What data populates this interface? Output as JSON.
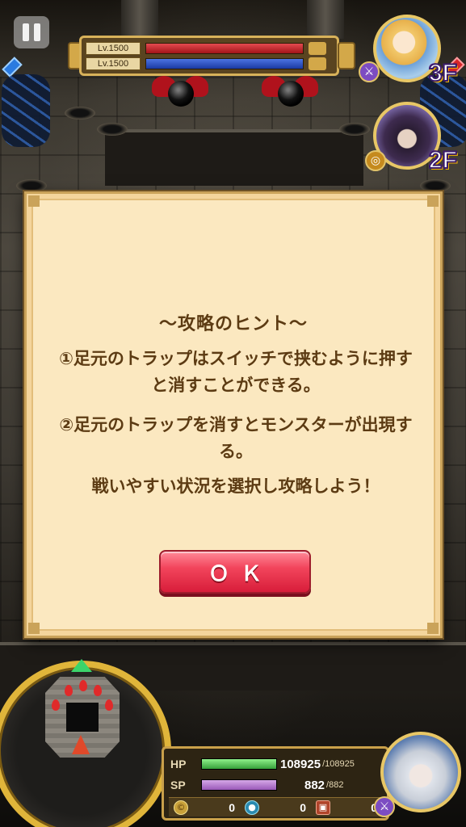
{
  "hud": {
    "pause_icon": "pause-icon",
    "boss": {
      "rows": [
        {
          "level": "Lv.1500",
          "bar": "red"
        },
        {
          "level": "Lv.1500",
          "bar": "blue"
        }
      ]
    },
    "party": [
      {
        "floor": "3F",
        "portrait": "blonde"
      },
      {
        "floor": "2F",
        "portrait": "dark"
      }
    ]
  },
  "dialog": {
    "title": "～攻略のヒント～",
    "hint1": "①足元のトラップはスイッチで挟むように押すと消すことができる。",
    "hint2": "②足元のトラップを消すとモンスターが出現する。",
    "hint3": "戦いやすい状況を選択し攻略しよう！",
    "ok_label": "ＯＫ"
  },
  "status": {
    "hp_label": "HP",
    "hp_value": "108925",
    "hp_max": "/108925",
    "hp_fraction": 1.0,
    "sp_label": "SP",
    "sp_value": "882",
    "sp_max": "/882",
    "sp_fraction": 1.0,
    "resources": [
      {
        "icon": "coin-icon",
        "value": "0"
      },
      {
        "icon": "drop-icon",
        "value": "0"
      },
      {
        "icon": "chest-icon",
        "value": "0"
      }
    ]
  },
  "colors": {
    "dialog_bg": "#fbe8c0",
    "dialog_text": "#5c3b13",
    "ok_button": "#f2455c",
    "hp_bar": "#36a03a",
    "sp_bar": "#9958b8",
    "ring_gold": "#e0b53a"
  }
}
